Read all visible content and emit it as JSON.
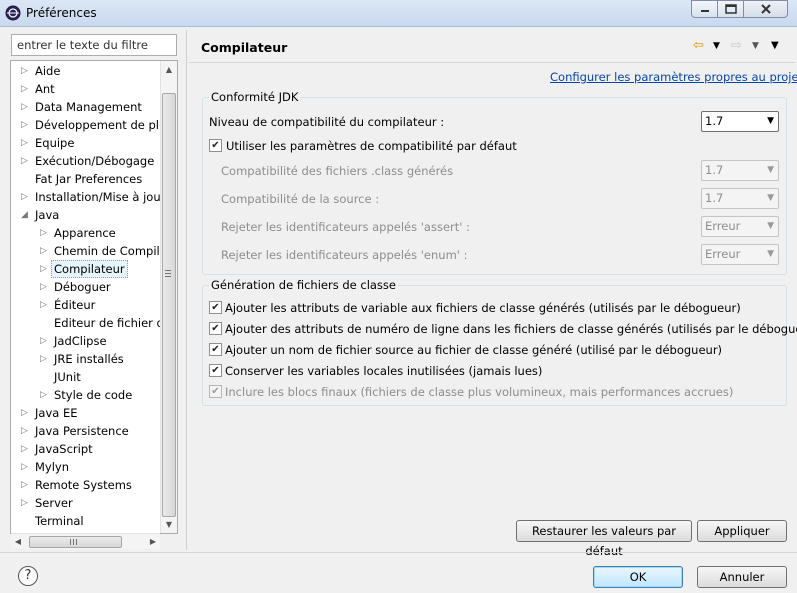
{
  "window": {
    "title": "Préférences"
  },
  "filter": {
    "placeholder": "entrer le texte du filtre"
  },
  "tree": [
    {
      "label": "Aide",
      "arrow": "▷",
      "indent": 0
    },
    {
      "label": "Ant",
      "arrow": "▷",
      "indent": 0
    },
    {
      "label": "Data Management",
      "arrow": "▷",
      "indent": 0
    },
    {
      "label": "Développement de plug",
      "arrow": "▷",
      "indent": 0
    },
    {
      "label": "Equipe",
      "arrow": "▷",
      "indent": 0
    },
    {
      "label": "Exécution/Débogage",
      "arrow": "▷",
      "indent": 0
    },
    {
      "label": "Fat Jar Preferences",
      "arrow": "",
      "indent": 0
    },
    {
      "label": "Installation/Mise à jour",
      "arrow": "▷",
      "indent": 0
    },
    {
      "label": "Java",
      "arrow": "◢",
      "indent": 0
    },
    {
      "label": "Apparence",
      "arrow": "▷",
      "indent": 1
    },
    {
      "label": "Chemin de Compila",
      "arrow": "▷",
      "indent": 1
    },
    {
      "label": "Compilateur",
      "arrow": "▷",
      "indent": 1,
      "selected": true
    },
    {
      "label": "Déboguer",
      "arrow": "▷",
      "indent": 1
    },
    {
      "label": "Éditeur",
      "arrow": "▷",
      "indent": 1
    },
    {
      "label": "Editeur de fichier de",
      "arrow": "",
      "indent": 1
    },
    {
      "label": "JadClipse",
      "arrow": "▷",
      "indent": 1
    },
    {
      "label": "JRE installés",
      "arrow": "▷",
      "indent": 1
    },
    {
      "label": "JUnit",
      "arrow": "",
      "indent": 1
    },
    {
      "label": "Style de code",
      "arrow": "▷",
      "indent": 1
    },
    {
      "label": "Java EE",
      "arrow": "▷",
      "indent": 0
    },
    {
      "label": "Java Persistence",
      "arrow": "▷",
      "indent": 0
    },
    {
      "label": "JavaScript",
      "arrow": "▷",
      "indent": 0
    },
    {
      "label": "Mylyn",
      "arrow": "▷",
      "indent": 0
    },
    {
      "label": "Remote Systems",
      "arrow": "▷",
      "indent": 0
    },
    {
      "label": "Server",
      "arrow": "▷",
      "indent": 0
    },
    {
      "label": "Terminal",
      "arrow": "",
      "indent": 0
    }
  ],
  "page": {
    "title": "Compilateur",
    "project_link": "Configurer les paramètres propres au projet...",
    "jdk": {
      "legend": "Conformité JDK",
      "level_label": "Niveau de compatibilité du compilateur :",
      "level_value": "1.7",
      "use_default_label": "Utiliser les paramètres de compatibilité par défaut",
      "class_compat_label": "Compatibilité des fichiers .class générés",
      "class_compat_value": "1.7",
      "source_compat_label": "Compatibilité de la source :",
      "source_compat_value": "1.7",
      "assert_label": "Rejeter les identificateurs appelés 'assert' :",
      "assert_value": "Erreur",
      "enum_label": "Rejeter les identificateurs appelés 'enum' :",
      "enum_value": "Erreur"
    },
    "classgen": {
      "legend": "Génération de fichiers de classe",
      "options": [
        {
          "label": "Ajouter les attributs de variable aux fichiers de classe générés (utilisés par le débogueur)",
          "checked": true,
          "disabled": false
        },
        {
          "label": "Ajouter des attributs de numéro de ligne dans les fichiers de classe générés (utilisés par le débogueur)",
          "checked": true,
          "disabled": false
        },
        {
          "label": "Ajouter un nom de fichier source au fichier de classe généré (utilisé par le débogueur)",
          "checked": true,
          "disabled": false
        },
        {
          "label": "Conserver les variables locales inutilisées (jamais lues)",
          "checked": true,
          "disabled": false
        },
        {
          "label": "Inclure les blocs finaux (fichiers de classe plus volumineux, mais performances accrues)",
          "checked": true,
          "disabled": true
        }
      ]
    },
    "restore_label": "Restaurer les valeurs par défaut",
    "apply_label": "Appliquer"
  },
  "footer": {
    "help_glyph": "?",
    "ok_label": "OK",
    "cancel_label": "Annuler"
  }
}
